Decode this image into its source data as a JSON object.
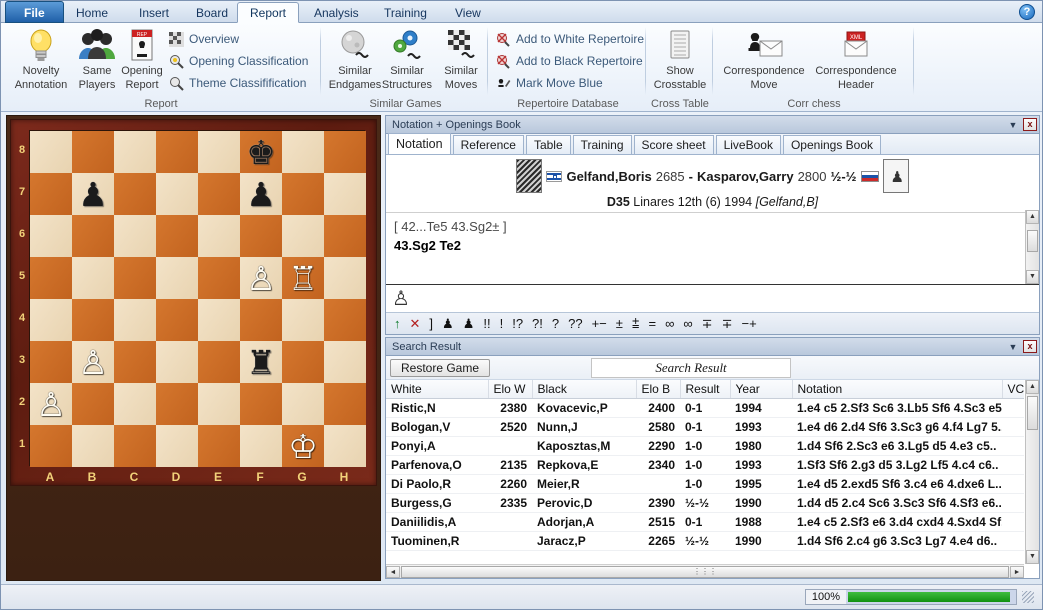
{
  "ribbon": {
    "tabs": [
      {
        "label": "File",
        "kind": "file"
      },
      {
        "label": "Home"
      },
      {
        "label": "Insert"
      },
      {
        "label": "Board"
      },
      {
        "label": "Report",
        "selected": true
      },
      {
        "label": "Analysis"
      },
      {
        "label": "Training"
      },
      {
        "label": "View"
      }
    ],
    "help_icon": "?",
    "groups": [
      {
        "name": "Report",
        "big_buttons": [
          {
            "label_line1": "Novelty",
            "label_line2": "Annotation",
            "icon": "lightbulb-icon"
          },
          {
            "label_line1": "Same",
            "label_line2": "Players",
            "icon": "people-icon"
          },
          {
            "label_line1": "Opening",
            "label_line2": "Report",
            "icon": "report-document-icon"
          }
        ],
        "small_buttons": [
          {
            "label": "Overview",
            "icon": "checkerboard-icon"
          },
          {
            "label": "Opening Classification",
            "icon": "magnifier-key-icon"
          },
          {
            "label": "Theme Classifification",
            "icon": "magnifier-icon"
          }
        ]
      },
      {
        "name": "Similar Games",
        "big_buttons": [
          {
            "label_line1": "Similar",
            "label_line2": "Endgames",
            "icon": "sphere-wave-icon"
          },
          {
            "label_line1": "Similar",
            "label_line2": "Structures",
            "icon": "gears-wave-icon"
          },
          {
            "label_line1": "Similar",
            "label_line2": "Moves",
            "icon": "checker-wave-icon"
          }
        ]
      },
      {
        "name": "Repertoire Database",
        "small_buttons": [
          {
            "label": "Add to White Repertoire",
            "icon": "add-white-repertoire-icon"
          },
          {
            "label": "Add to Black Repertoire",
            "icon": "add-black-repertoire-icon"
          },
          {
            "label": "Mark Move Blue",
            "icon": "mark-move-icon"
          }
        ]
      },
      {
        "name": "Cross Table",
        "big_buttons": [
          {
            "label_line1": "Show",
            "label_line2": "Crosstable",
            "icon": "table-list-icon"
          }
        ]
      },
      {
        "name": "Corr chess",
        "big_buttons": [
          {
            "label_line1": "Correspondence",
            "label_line2": "Move",
            "icon": "pawn-envelope-icon"
          },
          {
            "label_line1": "Correspondence",
            "label_line2": "Header",
            "icon": "xml-envelope-icon"
          }
        ]
      }
    ]
  },
  "board": {
    "files": [
      "A",
      "B",
      "C",
      "D",
      "E",
      "F",
      "G",
      "H"
    ],
    "ranks": [
      "8",
      "7",
      "6",
      "5",
      "4",
      "3",
      "2",
      "1"
    ],
    "position": [
      [
        "",
        "",
        "",
        "",
        "",
        "k",
        "",
        ""
      ],
      [
        "",
        "p",
        "",
        "",
        "",
        "p",
        "",
        ""
      ],
      [
        "",
        "",
        "",
        "",
        "",
        "",
        "",
        ""
      ],
      [
        "",
        "",
        "",
        "",
        "",
        "P",
        "R",
        ""
      ],
      [
        "",
        "",
        "",
        "",
        "",
        "",
        "",
        ""
      ],
      [
        "",
        "P",
        "",
        "",
        "",
        "r",
        "",
        ""
      ],
      [
        "P",
        "",
        "",
        "",
        "",
        "",
        "",
        ""
      ],
      [
        "",
        "",
        "",
        "",
        "",
        "",
        "K",
        ""
      ]
    ]
  },
  "notation_panel": {
    "title": "Notation + Openings Book",
    "caret_icon": "chevron-down-icon",
    "close_label": "x",
    "tabs": [
      {
        "label": "Notation",
        "selected": true
      },
      {
        "label": "Reference"
      },
      {
        "label": "Table"
      },
      {
        "label": "Training"
      },
      {
        "label": "Score sheet"
      },
      {
        "label": "LiveBook"
      },
      {
        "label": "Openings Book"
      }
    ],
    "game": {
      "white_name": "Gelfand,Boris",
      "white_elo": "2685",
      "dash": "-",
      "black_name": "Kasparov,Garry",
      "black_elo": "2800",
      "result": "½-½",
      "eco": "D35",
      "event": "Linares 12th (6) 1994",
      "annotator": "[Gelfand,B]",
      "white_flag": "israel-flag-icon",
      "black_flag": "russia-flag-icon"
    },
    "moves": {
      "variation": "[ 42...Te5  43.Sg2± ]",
      "mainline": "43.Sg2  Te2"
    },
    "eval_piece": "white-pawn-icon",
    "symbols": [
      "↑",
      "✕",
      "]",
      "♟",
      "♟",
      "!!",
      "!",
      "!?",
      "?!",
      "?",
      "??",
      "+−",
      "±",
      "⩲",
      "=",
      "∞",
      "∞",
      "∓",
      "∓",
      "−+"
    ]
  },
  "search_panel": {
    "title": "Search Result",
    "caret_icon": "chevron-down-icon",
    "close_label": "x",
    "restore_button": "Restore Game",
    "result_label": "Search Result",
    "columns": [
      "White",
      "Elo W",
      "Black",
      "Elo B",
      "Result",
      "Year",
      "Notation",
      "VC"
    ],
    "rows": [
      {
        "white": "Ristic,N",
        "elo_w": "2380",
        "black": "Kovacevic,P",
        "elo_b": "2400",
        "result": "0-1",
        "year": "1994",
        "notation": "1.e4 c5 2.Sf3 Sc6 3.Lb5 Sf6 4.Sc3 e5.."
      },
      {
        "white": "Bologan,V",
        "elo_w": "2520",
        "black": "Nunn,J",
        "elo_b": "2580",
        "result": "0-1",
        "year": "1993",
        "notation": "1.e4 d6 2.d4 Sf6 3.Sc3 g6 4.f4 Lg7 5.."
      },
      {
        "white": "Ponyi,A",
        "elo_w": "",
        "black": "Kaposztas,M",
        "elo_b": "2290",
        "result": "1-0",
        "year": "1980",
        "notation": "1.d4 Sf6 2.Sc3 e6 3.Lg5 d5 4.e3 c5.."
      },
      {
        "white": "Parfenova,O",
        "elo_w": "2135",
        "black": "Repkova,E",
        "elo_b": "2340",
        "result": "1-0",
        "year": "1993",
        "notation": "1.Sf3 Sf6 2.g3 d5 3.Lg2 Lf5 4.c4 c6.."
      },
      {
        "white": "Di Paolo,R",
        "elo_w": "2260",
        "black": "Meier,R",
        "elo_b": "",
        "result": "1-0",
        "year": "1995",
        "notation": "1.e4 d5 2.exd5 Sf6 3.c4 e6 4.dxe6 L.."
      },
      {
        "white": "Burgess,G",
        "elo_w": "2335",
        "black": "Perovic,D",
        "elo_b": "2390",
        "result": "½-½",
        "year": "1990",
        "notation": "1.d4 d5 2.c4 Sc6 3.Sc3 Sf6 4.Sf3 e6.."
      },
      {
        "white": "Daniilidis,A",
        "elo_w": "",
        "black": "Adorjan,A",
        "elo_b": "2515",
        "result": "0-1",
        "year": "1988",
        "notation": "1.e4 c5 2.Sf3 e6 3.d4 cxd4 4.Sxd4 Sf.."
      },
      {
        "white": "Tuominen,R",
        "elo_w": "",
        "black": "Jaracz,P",
        "elo_b": "2265",
        "result": "½-½",
        "year": "1990",
        "notation": "1.d4 Sf6 2.c4 g6 3.Sc3 Lg7 4.e4 d6.."
      }
    ]
  },
  "status": {
    "progress_label": "100%",
    "progress_percent": 100
  },
  "colors": {
    "accent": "#1f5fa8",
    "progress_green": "#119111",
    "board_light": "#f0ddbe",
    "board_dark": "#cb6b24",
    "panel_title": "#b9c8dc"
  }
}
